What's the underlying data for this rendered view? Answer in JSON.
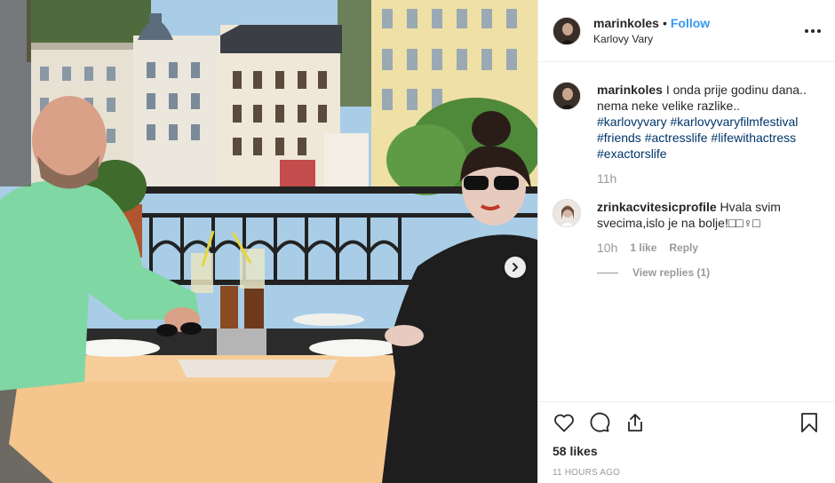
{
  "post": {
    "author": "marinkoles",
    "separator": "•",
    "follow_label": "Follow",
    "location": "Karlovy Vary",
    "more_icon": "more-horizontal-icon"
  },
  "caption": {
    "username": "marinkoles",
    "text": "I onda prije godinu dana.. nema neke velike razlike..",
    "tags": [
      "#karlovyvary",
      "#karlovyvaryfilmfestival",
      "#friends",
      "#actresslife",
      "#lifewithactress",
      "#exactorslife"
    ],
    "time": "11h"
  },
  "comments": [
    {
      "username": "zrinkacvitesicprofile",
      "text": "Hvala svim svecima,islo je na bolje!□□♀□",
      "time": "10h",
      "likes_label": "1 like",
      "reply_label": "Reply",
      "view_replies_label": "View replies (1)"
    }
  ],
  "actions": {
    "like_icon": "heart-icon",
    "comment_icon": "comment-icon",
    "share_icon": "share-icon",
    "save_icon": "bookmark-icon"
  },
  "likes_label": "58 likes",
  "timestamp": "11 HOURS AGO",
  "photo": {
    "next_icon": "chevron-right-icon",
    "colors": {
      "sky": "#a9cde6",
      "building_left": "#e7e1d4",
      "building_yellow": "#efe0a6",
      "railing": "#222222",
      "tablecloth": "#f4c58d",
      "sweater": "#7fd7a4",
      "jacket": "#1e1e1e"
    }
  }
}
